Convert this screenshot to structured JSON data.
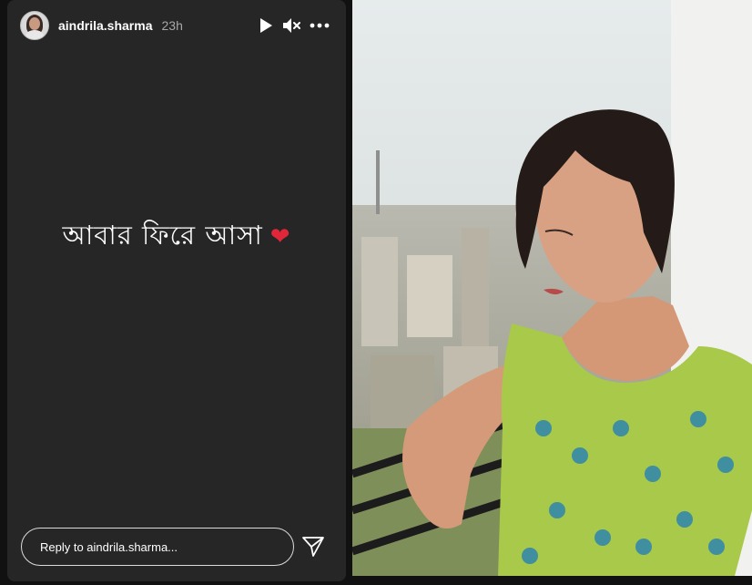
{
  "header": {
    "username": "aindrila.sharma",
    "time": "23h",
    "icons": [
      "play-icon",
      "mute-icon",
      "more-options-icon"
    ]
  },
  "story": {
    "text": "আবার ফিরে আসা",
    "emoji": "❤"
  },
  "reply": {
    "placeholder": "Reply to aindrila.sharma..."
  },
  "colors": {
    "panel": "#262626",
    "background": "#111111",
    "heart": "#e0273a",
    "dress": "#a8c94a"
  }
}
